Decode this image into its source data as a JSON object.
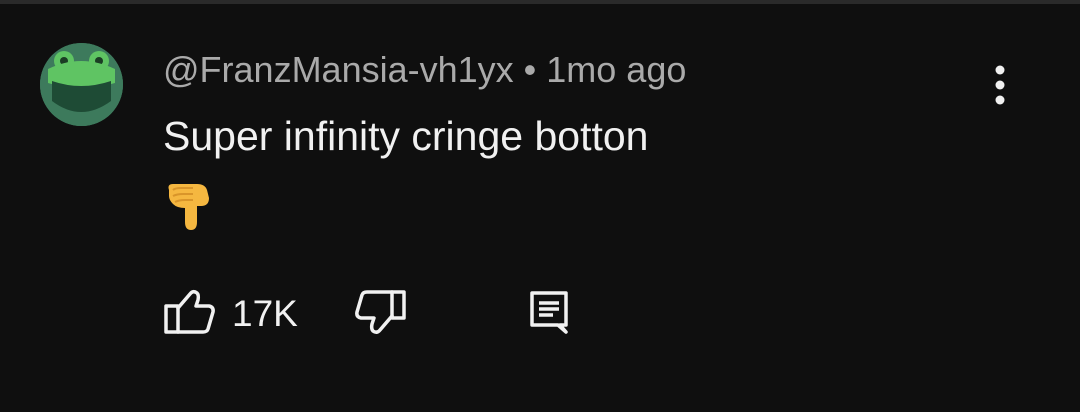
{
  "comment": {
    "author": "@FranzMansia-vh1yx",
    "separator": "•",
    "timestamp": "1mo ago",
    "text": "Super infinity cringe botton",
    "emoji": "backhand-index-pointing-down",
    "like_count": "17K"
  },
  "icons": {
    "avatar": "frog-avatar",
    "more": "more-vert-icon",
    "like": "thumb-up-icon",
    "dislike": "thumb-down-icon",
    "reply": "comment-icon"
  },
  "colors": {
    "background": "#0f0f0f",
    "text_primary": "#f1f1f1",
    "text_secondary": "#aaaaaa",
    "avatar_bg": "#3d7a5c",
    "frog_green": "#5fc463"
  }
}
